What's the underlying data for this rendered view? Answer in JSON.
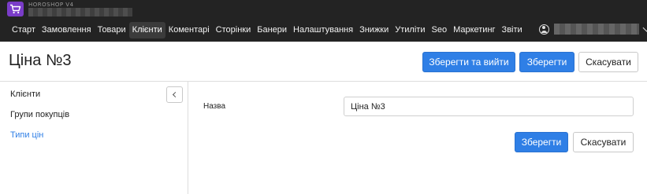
{
  "brand": {
    "name": "HOROSHOP V4"
  },
  "nav": [
    "Старт",
    "Замовлення",
    "Товари",
    "Клієнти",
    "Коментарі",
    "Сторінки",
    "Банери",
    "Налаштування",
    "Знижки",
    "Утиліти",
    "Seo",
    "Маркетинг",
    "Звіти"
  ],
  "nav_active": "Клієнти",
  "page": {
    "title": "Ціна №3",
    "save_exit_label": "Зберегти та вийти",
    "save_label": "Зберегти",
    "cancel_label": "Скасувати"
  },
  "sidebar": {
    "items": [
      {
        "label": "Клієнти",
        "active": false
      },
      {
        "label": "Групи покупців",
        "active": false
      },
      {
        "label": "Типи цін",
        "active": true
      }
    ]
  },
  "form": {
    "name_label": "Назва",
    "name_value": "Ціна №3",
    "save_label": "Зберегти",
    "cancel_label": "Скасувати"
  },
  "colors": {
    "accent": "#2f7fe6",
    "topbar": "#232323",
    "logo": "#7a3cc8"
  }
}
